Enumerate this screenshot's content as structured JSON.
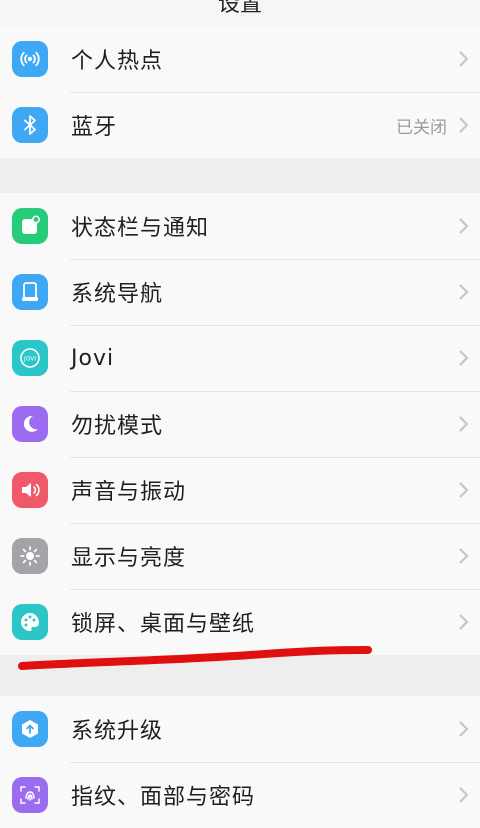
{
  "header": {
    "title": "设置"
  },
  "group1": [
    {
      "label": "个人热点",
      "icon": "hotspot-icon",
      "color": "#3fa8f5"
    },
    {
      "label": "蓝牙",
      "icon": "bluetooth-icon",
      "color": "#3fa8f5",
      "value": "已关闭"
    }
  ],
  "group2": [
    {
      "label": "状态栏与通知",
      "icon": "notification-icon",
      "color": "#27cc7a"
    },
    {
      "label": "系统导航",
      "icon": "navigation-icon",
      "color": "#3fa8f5"
    },
    {
      "label": "Jovi",
      "icon": "jovi-icon",
      "color": "#2bc6c8"
    },
    {
      "label": "勿扰模式",
      "icon": "moon-icon",
      "color": "#9b6cf0"
    },
    {
      "label": "声音与振动",
      "icon": "speaker-icon",
      "color": "#f0596a"
    },
    {
      "label": "显示与亮度",
      "icon": "brightness-icon",
      "color": "#a3a3a8"
    },
    {
      "label": "锁屏、桌面与壁纸",
      "icon": "palette-icon",
      "color": "#2bc6c8"
    }
  ],
  "group3": [
    {
      "label": "系统升级",
      "icon": "system-update-icon",
      "color": "#3fa8f5"
    },
    {
      "label": "指纹、面部与密码",
      "icon": "fingerprint-icon",
      "color": "#9b6cf0"
    }
  ],
  "annotation": {
    "color": "#e01010"
  }
}
